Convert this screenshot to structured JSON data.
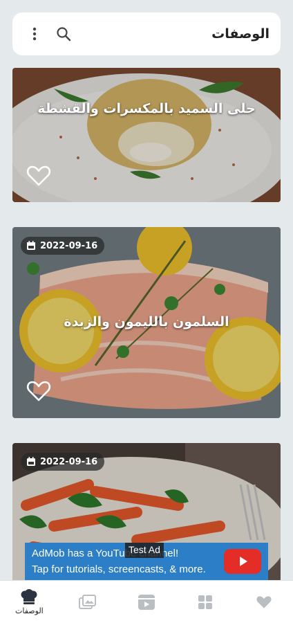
{
  "app": {
    "title": "الوصفات"
  },
  "recipes": [
    {
      "title": "حلى السميد بالمكسرات والقشطة",
      "date": ""
    },
    {
      "title": "السلمون بالليمون والزبدة",
      "date": "2022-09-16"
    },
    {
      "title": "",
      "date": "2022-09-16"
    }
  ],
  "ad": {
    "badge": "Test Ad",
    "line1": "AdMob has a YouTube channel!",
    "line2": "Tap for tutorials, screencasts, & more."
  },
  "nav": {
    "items": [
      {
        "label": "الوصفات",
        "icon": "chef-hat-icon"
      },
      {
        "label": "",
        "icon": "gallery-icon"
      },
      {
        "label": "",
        "icon": "video-icon"
      },
      {
        "label": "",
        "icon": "categories-icon"
      },
      {
        "label": "",
        "icon": "favorites-icon"
      }
    ]
  },
  "colors": {
    "accent": "#2c7fc6",
    "youtube": "#e52d27",
    "background": "#e4eaec"
  }
}
